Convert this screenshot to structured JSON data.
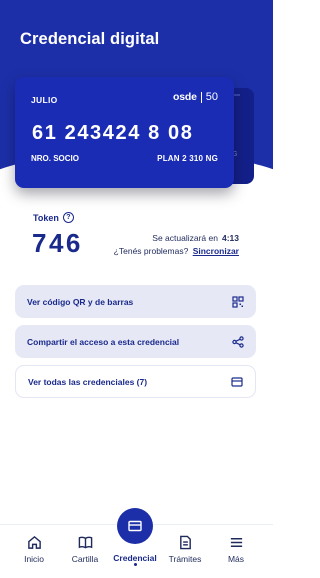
{
  "page": {
    "title": "Credencial digital"
  },
  "card": {
    "holder": "JULIO",
    "brand": "osde",
    "anniversary": "50",
    "number": "61 243424 8 08",
    "member_label": "NRO. SOCIO",
    "plan": "PLAN 2 310 NG",
    "back_card_partial_text": "G"
  },
  "token": {
    "label": "Token",
    "value": "746",
    "update_text": "Se actualizará en",
    "countdown": "4:13",
    "problems_text": "¿Tenés problemas?",
    "sync_link": "Sincronizar"
  },
  "actions": [
    {
      "label": "Ver código QR y de barras",
      "icon": "qr-code-icon"
    },
    {
      "label": "Compartir el acceso a esta credencial",
      "icon": "share-icon"
    },
    {
      "label": "Ver todas las credenciales (7)",
      "icon": "card-icon"
    }
  ],
  "nav": [
    {
      "label": "Inicio",
      "icon": "home-icon"
    },
    {
      "label": "Cartilla",
      "icon": "book-icon"
    },
    {
      "label": "Credencial",
      "icon": "credential-card-icon"
    },
    {
      "label": "Trámites",
      "icon": "document-icon"
    },
    {
      "label": "Más",
      "icon": "menu-icon"
    }
  ],
  "colors": {
    "primary": "#1d2fa8",
    "card": "#1a2cb4",
    "button_bg": "#e6e8f6",
    "text_dark": "#1a2a8c"
  }
}
